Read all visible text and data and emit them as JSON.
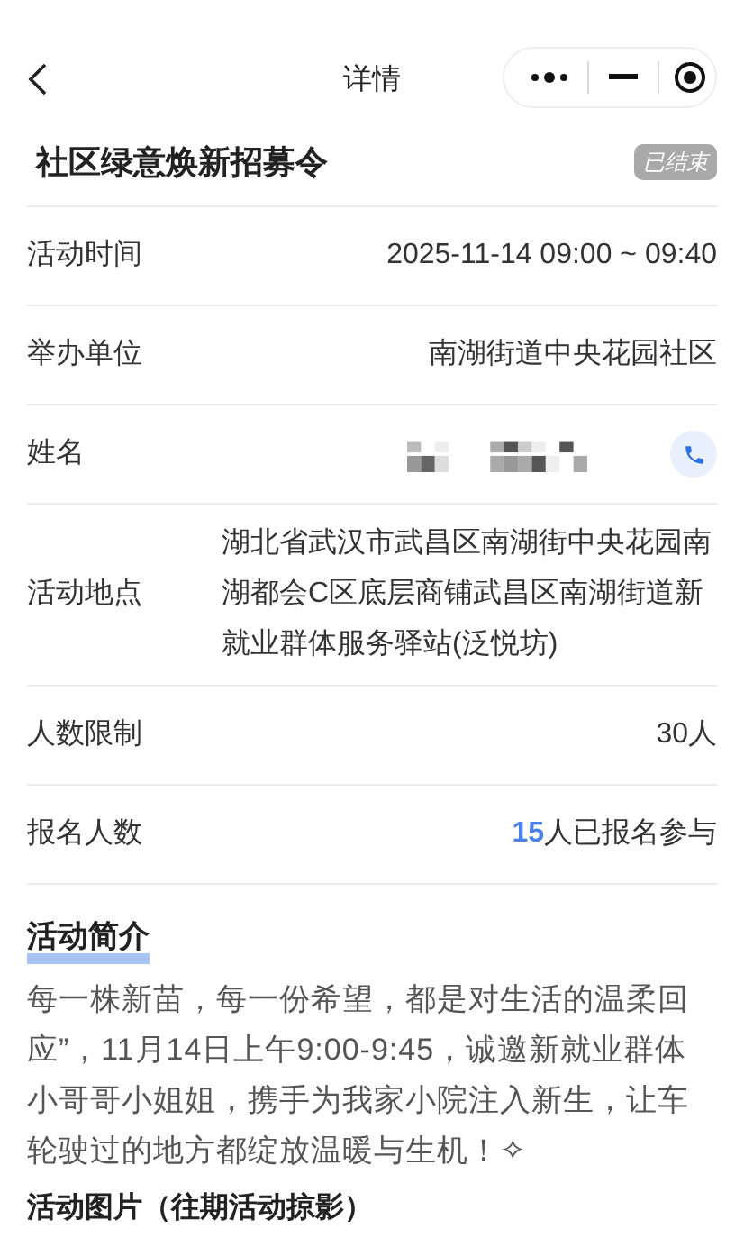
{
  "nav": {
    "title": "详情"
  },
  "activity": {
    "title": "社区绿意焕新招募令",
    "status": "已结束"
  },
  "rows": [
    {
      "kind": "text",
      "label": "活动时间",
      "value": "2025-11-14 09:00 ~ 09:40"
    },
    {
      "kind": "text",
      "label": "举办单位",
      "value": "南湖街道中央花园社区"
    },
    {
      "kind": "phone",
      "label": "姓名"
    },
    {
      "kind": "text",
      "label": "活动地点",
      "value": "湖北省武汉市武昌区南湖街中央花园南湖都会C区底层商铺武昌区南湖街道新就业群体服务驿站(泛悦坊)"
    },
    {
      "kind": "text",
      "label": "人数限制",
      "value": "30人"
    },
    {
      "kind": "count",
      "label": "报名人数",
      "count": "15",
      "value": "人已报名参与"
    }
  ],
  "intro": {
    "heading": "活动简介",
    "text": "每一株新苗，每一份希望，都是对生活的温柔回应”，11月14日上午9:00-9:45，诚邀新就业群体小哥哥小姐姐，携手为我家小院注入新生，让车轮驶过的地方都绽放温暖与生机！✧"
  },
  "photos": {
    "heading": "活动图片（往期活动掠影）"
  }
}
